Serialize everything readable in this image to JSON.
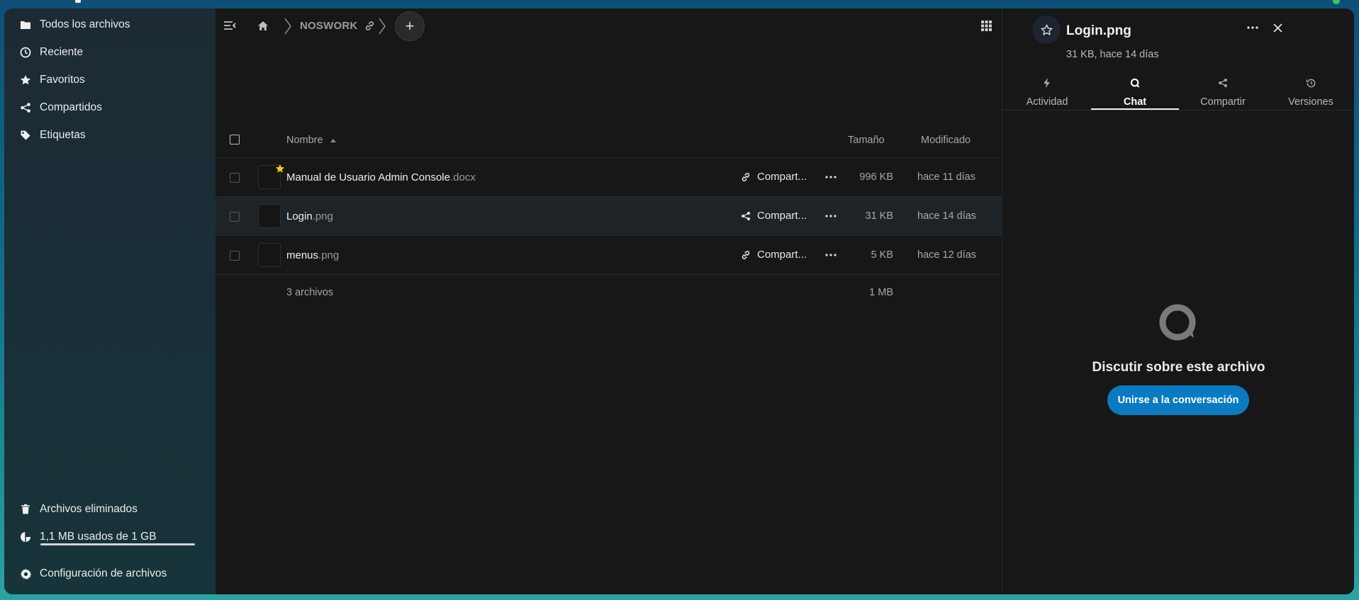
{
  "nav": {
    "items": [
      {
        "label": "Todos los archivos",
        "icon": "folder-icon"
      },
      {
        "label": "Reciente",
        "icon": "clock-icon"
      },
      {
        "label": "Favoritos",
        "icon": "star-icon"
      },
      {
        "label": "Compartidos",
        "icon": "share-icon"
      },
      {
        "label": "Etiquetas",
        "icon": "tag-icon"
      }
    ],
    "trash_label": "Archivos eliminados",
    "quota_label": "1,1 MB usados de 1 GB",
    "quota_fraction": 0.0011,
    "settings_label": "Configuración de archivos"
  },
  "breadcrumb": {
    "folder": "NOSWORK"
  },
  "table": {
    "headers": {
      "name": "Nombre",
      "size": "Tamaño",
      "modified": "Modificado"
    },
    "rows": [
      {
        "name": "Manual de Usuario Admin Console",
        "ext": ".docx",
        "share_label": "Compart...",
        "share_icon": "link-icon",
        "size": "996 KB",
        "modified": "hace 11 días",
        "favorite": true
      },
      {
        "name": "Login",
        "ext": ".png",
        "share_label": "Compart...",
        "share_icon": "share-icon",
        "size": "31 KB",
        "modified": "hace 14 días",
        "favorite": false
      },
      {
        "name": "menus",
        "ext": ".png",
        "share_label": "Compart...",
        "share_icon": "link-icon",
        "size": "5 KB",
        "modified": "hace 12 días",
        "favorite": false
      }
    ],
    "summary": {
      "count": "3 archivos",
      "size": "1 MB"
    }
  },
  "sidebar": {
    "title": "Login.png",
    "subtitle": "31 KB, hace 14 días",
    "tabs": [
      {
        "label": "Actividad",
        "icon": "bolt-icon"
      },
      {
        "label": "Chat",
        "icon": "chat-icon"
      },
      {
        "label": "Compartir",
        "icon": "share-icon"
      },
      {
        "label": "Versiones",
        "icon": "history-icon"
      }
    ],
    "active_tab": "Chat",
    "empty_title": "Discutir sobre este archivo",
    "join_label": "Unirse a la conversación"
  },
  "colors": {
    "accent": "#0a7bc2",
    "favorite": "#f5c518",
    "status_online": "#3cc46c"
  }
}
